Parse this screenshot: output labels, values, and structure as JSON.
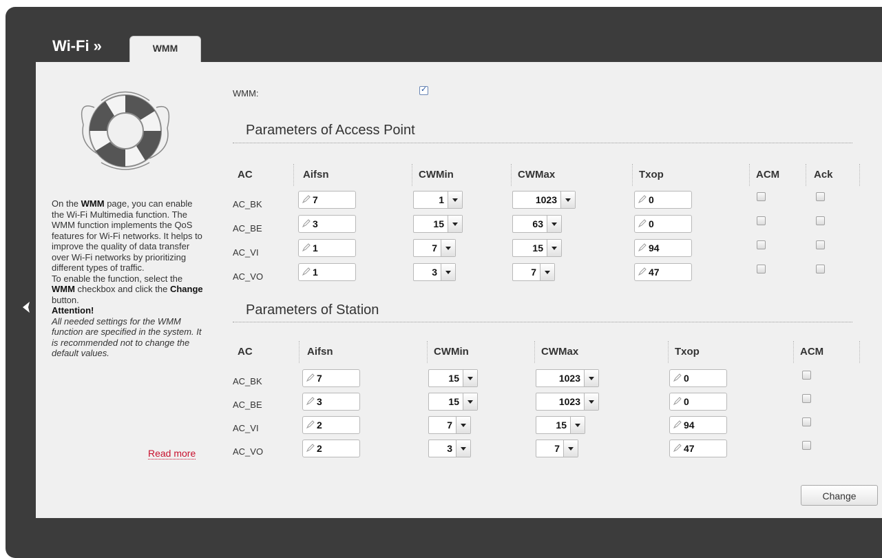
{
  "header": {
    "title": "Wi-Fi »",
    "tab_label": "WMM"
  },
  "help": {
    "intro_before": "On the ",
    "intro_bold": "WMM",
    "intro_after": " page, you can enable the Wi-Fi Multimedia function. The WMM function implements the QoS features for Wi-Fi networks. It helps to improve the quality of data transfer over Wi-Fi networks by prioritizing different types of traffic.",
    "enable_before": "To enable the function, select the ",
    "enable_bold1": "WMM",
    "enable_mid": " checkbox and click the ",
    "enable_bold2": "Change",
    "enable_after": " button.",
    "attention": "Attention!",
    "attention_text": "All needed settings for the WMM function are specified in the system. It is recommended not to change the default values.",
    "read_more": "Read more"
  },
  "wmm": {
    "label": "WMM:",
    "checked": true
  },
  "ap": {
    "title": "Parameters of Access Point",
    "headers": [
      "AC",
      "Aifsn",
      "CWMin",
      "CWMax",
      "Txop",
      "ACM",
      "Ack"
    ],
    "rows": [
      {
        "ac": "AC_BK",
        "aifsn": "7",
        "cwmin": "1",
        "cwmax": "1023",
        "txop": "0",
        "acm": false,
        "ack": false
      },
      {
        "ac": "AC_BE",
        "aifsn": "3",
        "cwmin": "15",
        "cwmax": "63",
        "txop": "0",
        "acm": false,
        "ack": false
      },
      {
        "ac": "AC_VI",
        "aifsn": "1",
        "cwmin": "7",
        "cwmax": "15",
        "txop": "94",
        "acm": false,
        "ack": false
      },
      {
        "ac": "AC_VO",
        "aifsn": "1",
        "cwmin": "3",
        "cwmax": "7",
        "txop": "47",
        "acm": false,
        "ack": false
      }
    ]
  },
  "station": {
    "title": "Parameters of Station",
    "headers": [
      "AC",
      "Aifsn",
      "CWMin",
      "CWMax",
      "Txop",
      "ACM"
    ],
    "rows": [
      {
        "ac": "AC_BK",
        "aifsn": "7",
        "cwmin": "15",
        "cwmax": "1023",
        "txop": "0",
        "acm": false
      },
      {
        "ac": "AC_BE",
        "aifsn": "3",
        "cwmin": "15",
        "cwmax": "1023",
        "txop": "0",
        "acm": false
      },
      {
        "ac": "AC_VI",
        "aifsn": "2",
        "cwmin": "7",
        "cwmax": "15",
        "txop": "94",
        "acm": false
      },
      {
        "ac": "AC_VO",
        "aifsn": "2",
        "cwmin": "3",
        "cwmax": "7",
        "txop": "47",
        "acm": false
      }
    ]
  },
  "buttons": {
    "change": "Change"
  },
  "colors": {
    "frame": "#3c3c3c",
    "panel": "#f0f0f0",
    "read_more": "#c8102e"
  },
  "icons": {
    "back": "chevron-left-icon",
    "help_image": "lifebuoy-icon",
    "edit": "pencil-icon"
  }
}
